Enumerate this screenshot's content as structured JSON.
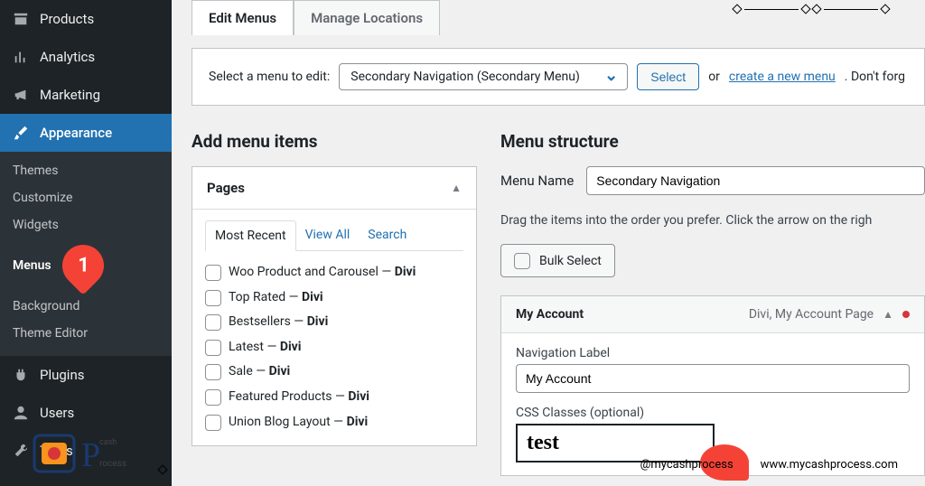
{
  "sidebar": {
    "items": [
      {
        "label": "Products"
      },
      {
        "label": "Analytics"
      },
      {
        "label": "Marketing"
      },
      {
        "label": "Appearance"
      },
      {
        "label": "Plugins"
      },
      {
        "label": "Users"
      },
      {
        "label": "Tools"
      }
    ],
    "submenu": [
      {
        "label": "Themes"
      },
      {
        "label": "Customize"
      },
      {
        "label": "Widgets"
      },
      {
        "label": "Menus"
      },
      {
        "label": "Background"
      },
      {
        "label": "Theme Editor"
      }
    ]
  },
  "tabs": {
    "edit": "Edit Menus",
    "manage": "Manage Locations"
  },
  "select_bar": {
    "label": "Select a menu to edit:",
    "dropdown": "Secondary Navigation (Secondary Menu)",
    "select_btn": "Select",
    "or": "or",
    "link": "create a new menu",
    "tail": ". Don't forg"
  },
  "left": {
    "heading": "Add menu items",
    "panel_title": "Pages",
    "mini_tabs": {
      "a": "Most Recent",
      "b": "View All",
      "c": "Search"
    },
    "pages": [
      {
        "text": "Woo Product and Carousel — ",
        "suffix": "Divi"
      },
      {
        "text": "Top Rated — ",
        "suffix": "Divi"
      },
      {
        "text": "Bestsellers — ",
        "suffix": "Divi"
      },
      {
        "text": "Latest — ",
        "suffix": "Divi"
      },
      {
        "text": "Sale — ",
        "suffix": "Divi"
      },
      {
        "text": "Featured Products — ",
        "suffix": "Divi"
      },
      {
        "text": "Union Blog Layout — ",
        "suffix": "Divi"
      }
    ]
  },
  "right": {
    "heading": "Menu structure",
    "name_label": "Menu Name",
    "name_value": "Secondary Navigation",
    "help": "Drag the items into the order you prefer. Click the arrow on the righ",
    "bulk": "Bulk Select",
    "item": {
      "title": "My Account",
      "meta": "Divi, My Account Page"
    },
    "nav_label_label": "Navigation Label",
    "nav_label_value": "My Account",
    "css_label": "CSS Classes (optional)",
    "css_value": "test"
  },
  "markers": {
    "m1": "1"
  },
  "watermark": {
    "handle": "@mycashprocess",
    "url": "www.mycashprocess.com"
  }
}
